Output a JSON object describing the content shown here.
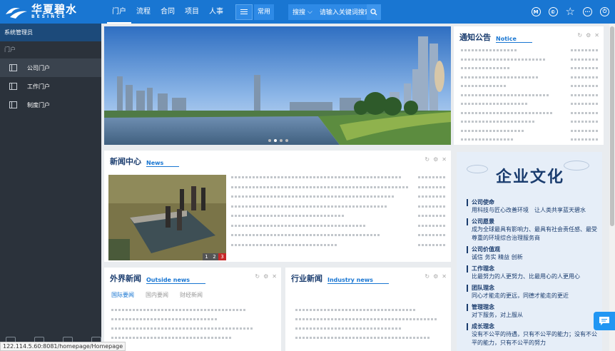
{
  "brand": {
    "name_cn": "华夏碧水",
    "name_en": "BESINCE"
  },
  "nav": [
    "门户",
    "流程",
    "合同",
    "项目",
    "人事"
  ],
  "common_label": "常用",
  "search": {
    "scope": "搜搜",
    "placeholder": "请输入关键词搜索"
  },
  "top_icons": [
    "M",
    "©"
  ],
  "sidebar": {
    "header": "系统管理员",
    "section": "门户",
    "items": [
      {
        "label": "公司门户",
        "active": true
      },
      {
        "label": "工作门户",
        "active": false
      },
      {
        "label": "制度门户",
        "active": false
      }
    ]
  },
  "notice": {
    "title": "通知公告",
    "title_en": "Notice"
  },
  "news": {
    "title": "新闻中心",
    "title_en": "News",
    "pager": [
      "1",
      "2",
      "3"
    ]
  },
  "outside_news": {
    "title": "外界新闻",
    "title_en": "Outside news",
    "tabs": [
      "国际要闻",
      "国内要闻",
      "财经新闻"
    ]
  },
  "industry_news": {
    "title": "行业新闻",
    "title_en": "Industry news"
  },
  "culture": {
    "title": "企业文化",
    "items": [
      {
        "head": "公司使命",
        "body": "用科技与匠心改善环境　让人类共享蓝天碧水"
      },
      {
        "head": "公司愿景",
        "body": "成为全球最具有影响力、最具有社会责任感、最受尊重的环境综合治理服务商"
      },
      {
        "head": "公司价值观",
        "body": "诚信 务实 精益 创新"
      },
      {
        "head": "工作理念",
        "body": "比最努力的人更努力、比最用心的人更用心"
      },
      {
        "head": "团队理念",
        "body": "同心才能走的更远，同德才能走的更近"
      },
      {
        "head": "管理理念",
        "body": "对下服务，对上服从"
      },
      {
        "head": "成长理念",
        "body": "没有不公平的待遇，只有不公平的能力；没有不公平的能力，只有不公平的努力"
      }
    ]
  },
  "status_url": "122.114.5.60:8081/homepage/Homepage"
}
